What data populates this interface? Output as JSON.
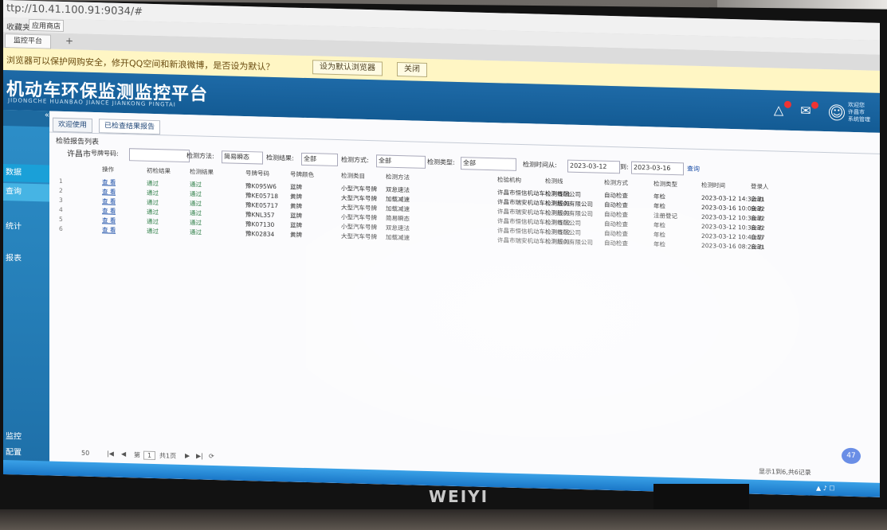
{
  "browser": {
    "url": "ttp://10.41.100.91:9034/#",
    "favorites": [
      "收藏夹",
      "应用商店"
    ],
    "tab_label": "监控平台",
    "new_tab": "+",
    "notice": {
      "text": "浏览器可以保护网购安全，修开QQ空间和新浪微博，是否设为默认？",
      "btn_default": "设为默认浏览器",
      "btn_close": "关闭"
    }
  },
  "header": {
    "title": "机动车环保监测监控平台",
    "subtitle": "JIDONGCHE HUANBAO JIANCE JIANKONG PINGTAI",
    "user_lines": [
      "欢迎您",
      "许昌市",
      "系统管理"
    ]
  },
  "sidebar": {
    "top_label": "«",
    "items": [
      "数据",
      "查询",
      "统计",
      "报表",
      "监控",
      "配置"
    ]
  },
  "content": {
    "tabs": [
      "欢迎使用",
      "已检查结果报告"
    ],
    "panel_title": "检验报告列表",
    "filter": {
      "city": "许昌市",
      "plate_label": "号牌号码:",
      "plate_value": "",
      "time_label": "检测方法:",
      "time_value": "简易瞬态",
      "result_label": "检测结果:",
      "result_value": "全部",
      "method_label": "检测方式:",
      "method_value": "全部",
      "mode_label": "检测类型:",
      "mode_value": "全部",
      "date_label": "检测时间从:",
      "date_from": "2023-03-12",
      "date_to_label": "到:",
      "date_to": "2023-03-16",
      "query_btn": "查询"
    },
    "columns": [
      "操作",
      "初检结果",
      "检测结果",
      "号牌号码",
      "号牌颜色",
      "检测类目",
      "检测方法",
      "检验机构",
      "检测线",
      "检测方式",
      "检测类型",
      "检测时间",
      "登录人"
    ],
    "rows": [
      {
        "n": "1",
        "op": "查 看",
        "r1": "通过",
        "r2": "通过",
        "plate": "豫K095W6",
        "color": "蓝牌",
        "cat": "小型汽车号牌",
        "method": "双怠速法",
        "org": "许昌市恒信机动车检测有限公司",
        "line": "检测线01",
        "way": "自动检查",
        "type": "年检",
        "time": "2023-03-12 14:32:31",
        "user": "自动"
      },
      {
        "n": "2",
        "op": "查 看",
        "r1": "通过",
        "r2": "通过",
        "plate": "豫KE05718",
        "color": "黄牌",
        "cat": "大型汽车号牌",
        "method": "加载减速",
        "org": "许昌市瑞安机动车检测服务有限公司",
        "line": "检测线01",
        "way": "自动检查",
        "type": "年检",
        "time": "2023-03-16 10:09:32",
        "user": "自动"
      },
      {
        "n": "3",
        "op": "查 看",
        "r1": "通过",
        "r2": "通过",
        "plate": "豫KE05717",
        "color": "黄牌",
        "cat": "大型汽车号牌",
        "method": "加载减速",
        "org": "许昌市瑞安机动车检测服务有限公司",
        "line": "检测线01",
        "way": "自动检查",
        "type": "注册登记",
        "time": "2023-03-12 10:38:32",
        "user": "自动"
      },
      {
        "n": "4",
        "op": "查 看",
        "r1": "通过",
        "r2": "通过",
        "plate": "豫KNL357",
        "color": "蓝牌",
        "cat": "小型汽车号牌",
        "method": "简易瞬态",
        "org": "许昌市恒信机动车检测有限公司",
        "line": "检测线02",
        "way": "自动检查",
        "type": "年检",
        "time": "2023-03-12 10:38:32",
        "user": "自动"
      },
      {
        "n": "5",
        "op": "查 看",
        "r1": "通过",
        "r2": "通过",
        "plate": "豫K07130",
        "color": "蓝牌",
        "cat": "小型汽车号牌",
        "method": "双怠速法",
        "org": "许昌市恒信机动车检测有限公司",
        "line": "检测线02",
        "way": "自动检查",
        "type": "年检",
        "time": "2023-03-12 10:40:57",
        "user": "自动"
      },
      {
        "n": "6",
        "op": "查 看",
        "r1": "通过",
        "r2": "通过",
        "plate": "豫K02834",
        "color": "黄牌",
        "cat": "大型汽车号牌",
        "method": "加载减速",
        "org": "许昌市瑞安机动车检测服务有限公司",
        "line": "检测线01",
        "way": "自动检查",
        "type": "年检",
        "time": "2023-03-16 08:28:31",
        "user": "自动"
      }
    ],
    "pager": {
      "page_size": "50",
      "page_prefix": "第",
      "page_value": "1",
      "page_suffix": "共1页",
      "summary": "显示1到6,共6记录"
    },
    "badge": "47"
  },
  "taskbar": {
    "tray": "▲ ♪ ☐"
  },
  "monitor": {
    "brand": "WEIYI"
  }
}
